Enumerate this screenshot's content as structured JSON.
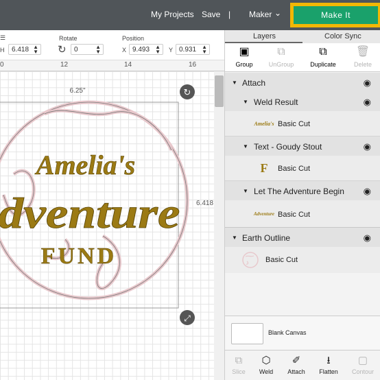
{
  "topbar": {
    "my_projects": "My Projects",
    "save": "Save",
    "separator": "|",
    "machine": "Maker",
    "make_it": "Make It"
  },
  "props": {
    "h_label": "H",
    "h_value": "6.418",
    "rotate_label": "Rotate",
    "rotate_value": "0",
    "position_label": "Position",
    "x_label": "X",
    "x_value": "9.493",
    "y_label": "Y",
    "y_value": "0.931"
  },
  "ruler": {
    "ticks": [
      "0",
      "12",
      "14",
      "16"
    ]
  },
  "canvas": {
    "width_label": "6.25\"",
    "height_label": "6.418",
    "design": {
      "line1": "Amelia's",
      "line2": "dventure",
      "line3": "FUND",
      "text_color": "#9b7a14",
      "outline_color": "#e8c8cc"
    }
  },
  "panel": {
    "tabs": [
      "Layers",
      "Color Sync"
    ],
    "tools": {
      "group": "Group",
      "ungroup": "UnGroup",
      "duplicate": "Duplicate",
      "delete": "Delete"
    },
    "layers": [
      {
        "name": "Attach"
      },
      {
        "name": "Weld Result",
        "child": "Basic Cut",
        "thumb": "Amelia's"
      },
      {
        "name": "Text - Goudy Stout",
        "child": "Basic Cut",
        "thumb": "F"
      },
      {
        "name": "Let The Adventure Begin",
        "child": "Basic Cut",
        "thumb": "Adventure"
      },
      {
        "name": "Earth Outline",
        "child": "Basic Cut"
      }
    ],
    "blank_canvas": "Blank Canvas",
    "bottom_tools": {
      "slice": "Slice",
      "weld": "Weld",
      "attach": "Attach",
      "flatten": "Flatten",
      "contour": "Contour"
    }
  },
  "colors": {
    "topbar": "#505559",
    "make_it_bg": "#1aa16b",
    "highlight": "#f2b705"
  }
}
